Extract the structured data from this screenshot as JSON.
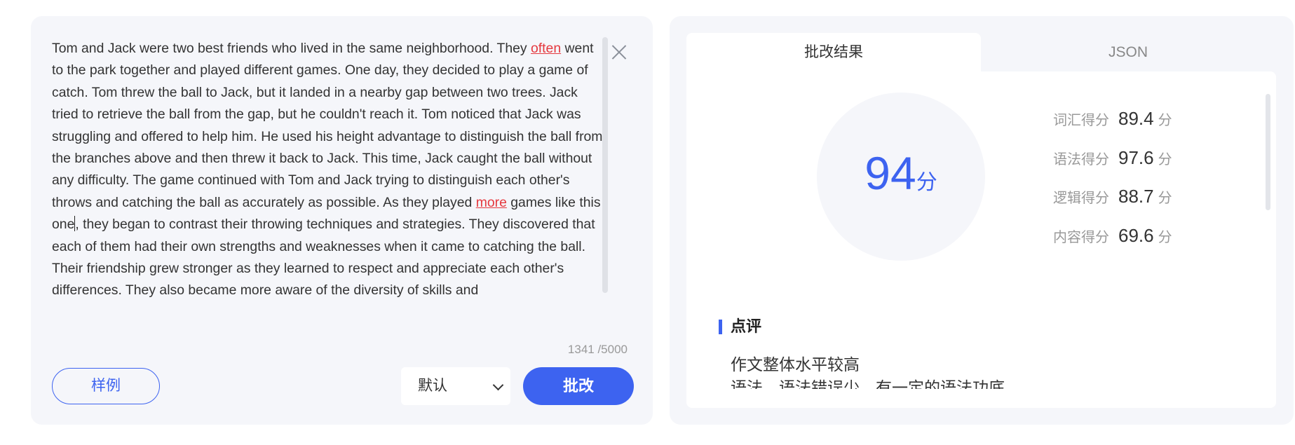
{
  "essay": {
    "p1": "Tom and Jack were two best friends who lived in the same neighborhood. They ",
    "err1": "often",
    "p2": " went to the park together and played different games. One day, they decided to play a game of catch. Tom threw the ball to Jack, but it landed in a nearby gap between two trees. Jack tried to retrieve the ball from the gap, but he couldn't reach it. Tom noticed that Jack was struggling and offered to help him. He used his height advantage to distinguish the ball from the branches above and then threw it back to Jack. This time, Jack caught the ball without any difficulty. The game continued with Tom and Jack trying to distinguish each other's throws and catching the ball as accurately as possible. As they played ",
    "err2": "more",
    "p3": " games like this one",
    "p4": ", they began to contrast their throwing techniques and strategies. They discovered that each of them had their own strengths and weaknesses when it came to catching the ball. Their friendship grew stronger as they learned to respect and appreciate each other's differences. They also became more aware of the diversity of skills and"
  },
  "counter": "1341 /5000",
  "buttons": {
    "sample": "样例",
    "correct": "批改"
  },
  "mode_select": {
    "value": "默认"
  },
  "tabs": {
    "result": "批改结果",
    "json": "JSON"
  },
  "scores": {
    "total": "94",
    "total_unit": "分",
    "items": [
      {
        "label": "词汇得分",
        "value": "89.4",
        "unit": "分"
      },
      {
        "label": "语法得分",
        "value": "97.6",
        "unit": "分"
      },
      {
        "label": "逻辑得分",
        "value": "88.7",
        "unit": "分"
      },
      {
        "label": "内容得分",
        "value": "69.6",
        "unit": "分"
      }
    ]
  },
  "review": {
    "title": "点评",
    "line1": "作文整体水平较高",
    "line2": "语法、语法错误少，有一定的语法功底"
  },
  "colors": {
    "accent": "#3d63f0",
    "error": "#e5393f",
    "card_bg": "#f5f6fa"
  }
}
